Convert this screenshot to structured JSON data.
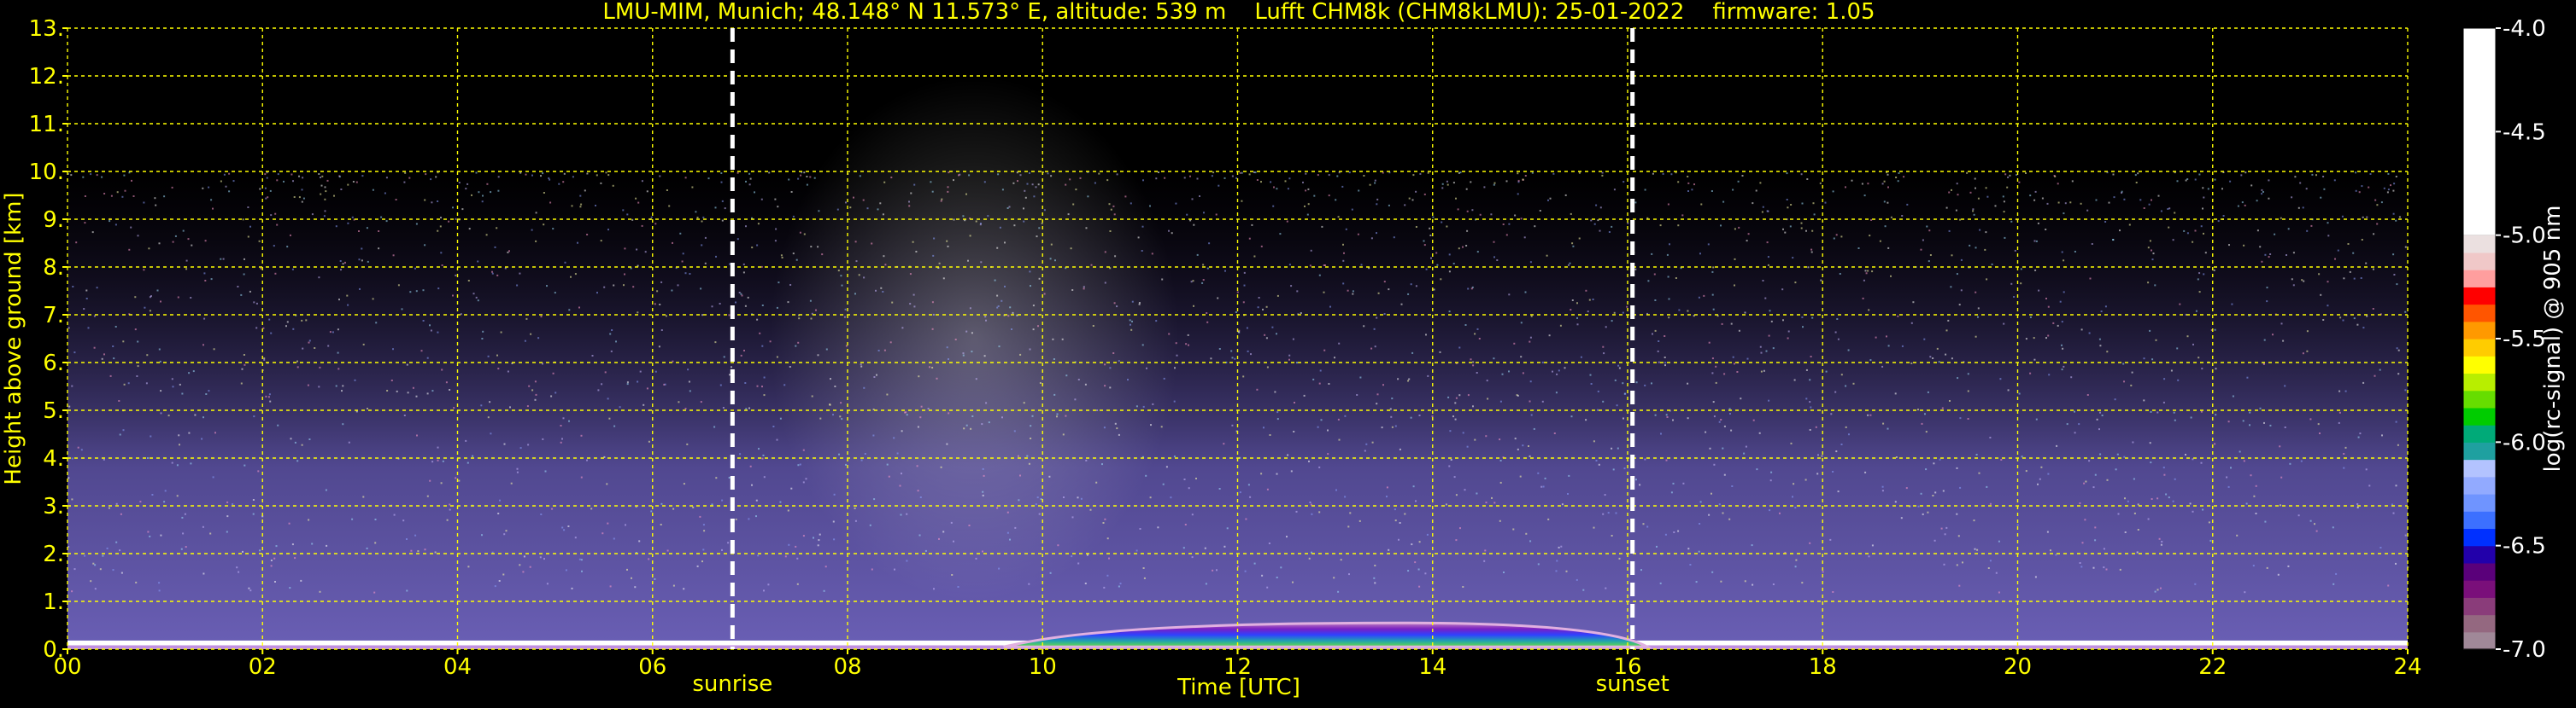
{
  "chart_data": {
    "type": "heatmap",
    "title": "LMU-MIM, Munich; 48.148° N 11.573° E, altitude: 539 m    Lufft CHM8k (CHM8kLMU): 25-01-2022    firmware: 1.05",
    "xlabel": "Time [UTC]",
    "ylabel": "Height above ground [km]",
    "xlim": [
      0,
      24
    ],
    "ylim": [
      0,
      13
    ],
    "x_ticks": [
      "00",
      "02",
      "04",
      "06",
      "08",
      "10",
      "12",
      "14",
      "16",
      "18",
      "20",
      "22",
      "24"
    ],
    "y_ticks": [
      "0.",
      "1.",
      "2.",
      "3.",
      "4.",
      "5.",
      "6.",
      "7.",
      "8.",
      "9.",
      "10.",
      "11.",
      "12.",
      "13."
    ],
    "grid": true,
    "data_top_km": 10.0,
    "markers": [
      {
        "label": "sunrise",
        "time": 6.82
      },
      {
        "label": "sunset",
        "time": 16.05
      }
    ],
    "aerosol_layer": {
      "start": 9.6,
      "end": 16.2,
      "top_km": 0.55
    },
    "colorbar": {
      "label": "log(rc-signal) @ 905 nm",
      "ticks": [
        "-4.0",
        "-4.5",
        "-5.0",
        "-5.5",
        "-6.0",
        "-6.5",
        "-7.0"
      ],
      "min": -7.0,
      "max": -4.0,
      "colors": [
        "#a08898",
        "#946880",
        "#8a3c7a",
        "#7a0f7a",
        "#5a007a",
        "#2200aa",
        "#0030ff",
        "#3c70ff",
        "#6f94ff",
        "#92aaff",
        "#b3c3ff",
        "#1fa0a0",
        "#00aa78",
        "#00cc00",
        "#66dd00",
        "#b8ee00",
        "#ffff00",
        "#ffcc00",
        "#ff9900",
        "#ff5500",
        "#ff0000",
        "#ff9e9e",
        "#f0c8c8",
        "#ebe0e0"
      ]
    }
  }
}
